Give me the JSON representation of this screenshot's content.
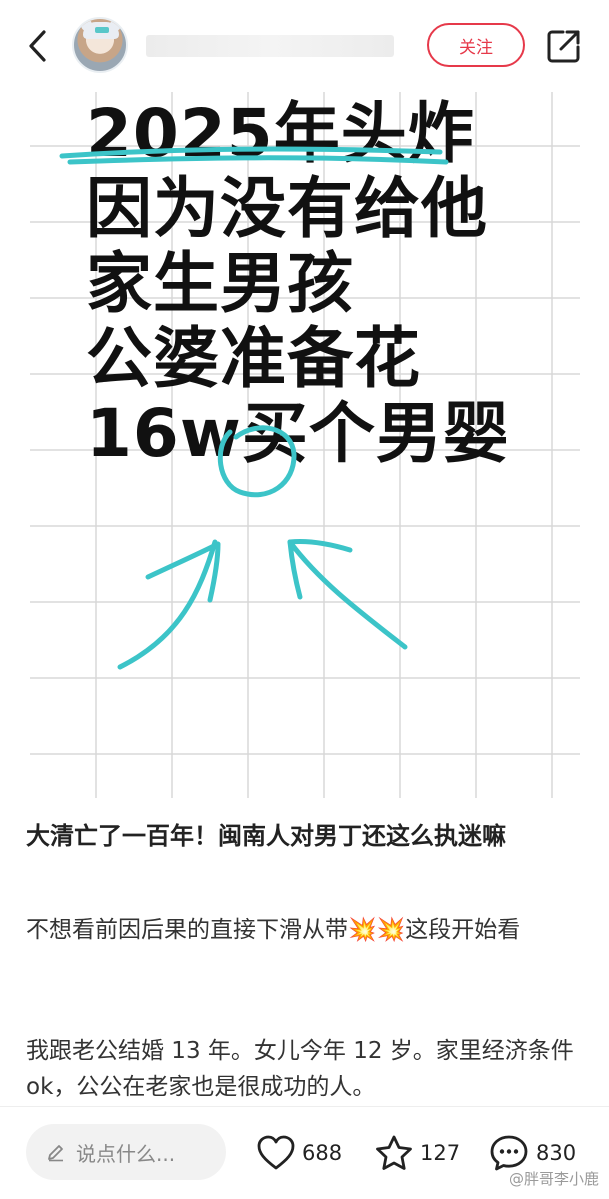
{
  "header": {
    "back_icon": "chevron-left-icon",
    "follow_label": "关注",
    "share_icon": "share-out-icon"
  },
  "image": {
    "headline_lines": [
      "2025年头炸",
      "因为没有给他",
      "家生男孩",
      "公婆准备花",
      "16w买个男婴"
    ],
    "scribble_color": "#3cc4c8"
  },
  "post": {
    "title": "大清亡了一百年！闽南人对男丁还这么执迷嘛",
    "para1": "不想看前因后果的直接下滑从带💥💥这段开始看",
    "para2": "我跟老公结婚 13 年。女儿今年 12 岁。家里经济条件 ok，公公在老家也是很成功的人。"
  },
  "bottom": {
    "comment_placeholder": "说点什么...",
    "likes": "688",
    "favorites": "127",
    "comments": "830",
    "watermark": "@胖哥李小鹿"
  },
  "colors": {
    "accent": "#e6394a",
    "grid": "#d8d8d8"
  }
}
